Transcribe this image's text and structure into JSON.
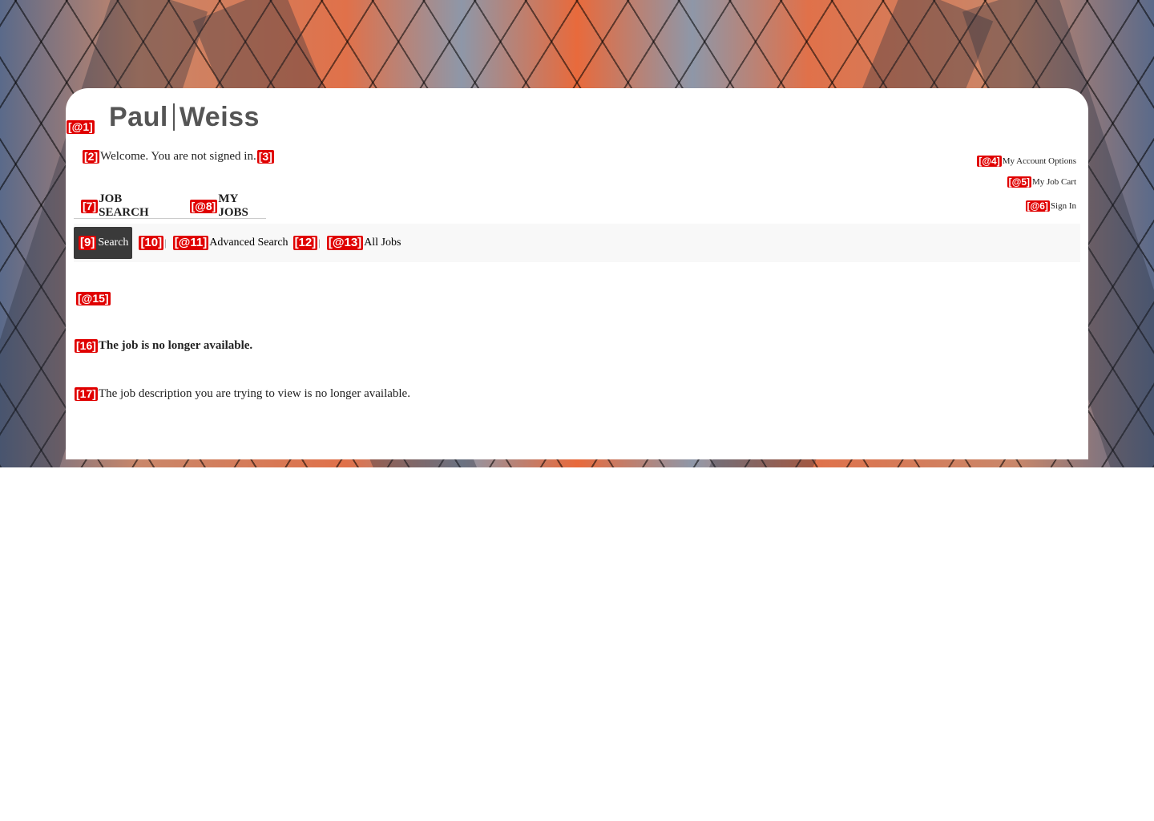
{
  "badges": {
    "logo": "[@1]",
    "welcome_start": "[2]",
    "welcome_end": "[3]",
    "account_options": "[@4]",
    "job_cart": "[@5]",
    "sign_in": "[@6]",
    "job_search": "[7]",
    "my_jobs": "[@8]",
    "search": "[9]",
    "sep1": "[10]",
    "advanced_search": "[@11]",
    "sep2": "[12]",
    "all_jobs": "[@13]",
    "anchor": "[@15]",
    "msg_title": "[16]",
    "msg_body": "[17]"
  },
  "header": {
    "logo_left": "Paul",
    "logo_right": "Weiss",
    "welcome_text": "Welcome. You are not signed in."
  },
  "account": {
    "options": "My Account Options",
    "job_cart": "My Job Cart",
    "sign_in": "Sign In"
  },
  "tabs": {
    "job_search": "JOB SEARCH",
    "my_jobs": "MY JOBS"
  },
  "subnav": {
    "search": "Search",
    "separator": "|",
    "advanced_search": "Advanced Search",
    "all_jobs": "All Jobs"
  },
  "message": {
    "title": "The job is no longer available.",
    "body": "The job description you are trying to view is no longer available."
  },
  "colors": {
    "badge": "#e00000",
    "active_tab_bg": "#3a3a3a",
    "logo": "#555555"
  }
}
